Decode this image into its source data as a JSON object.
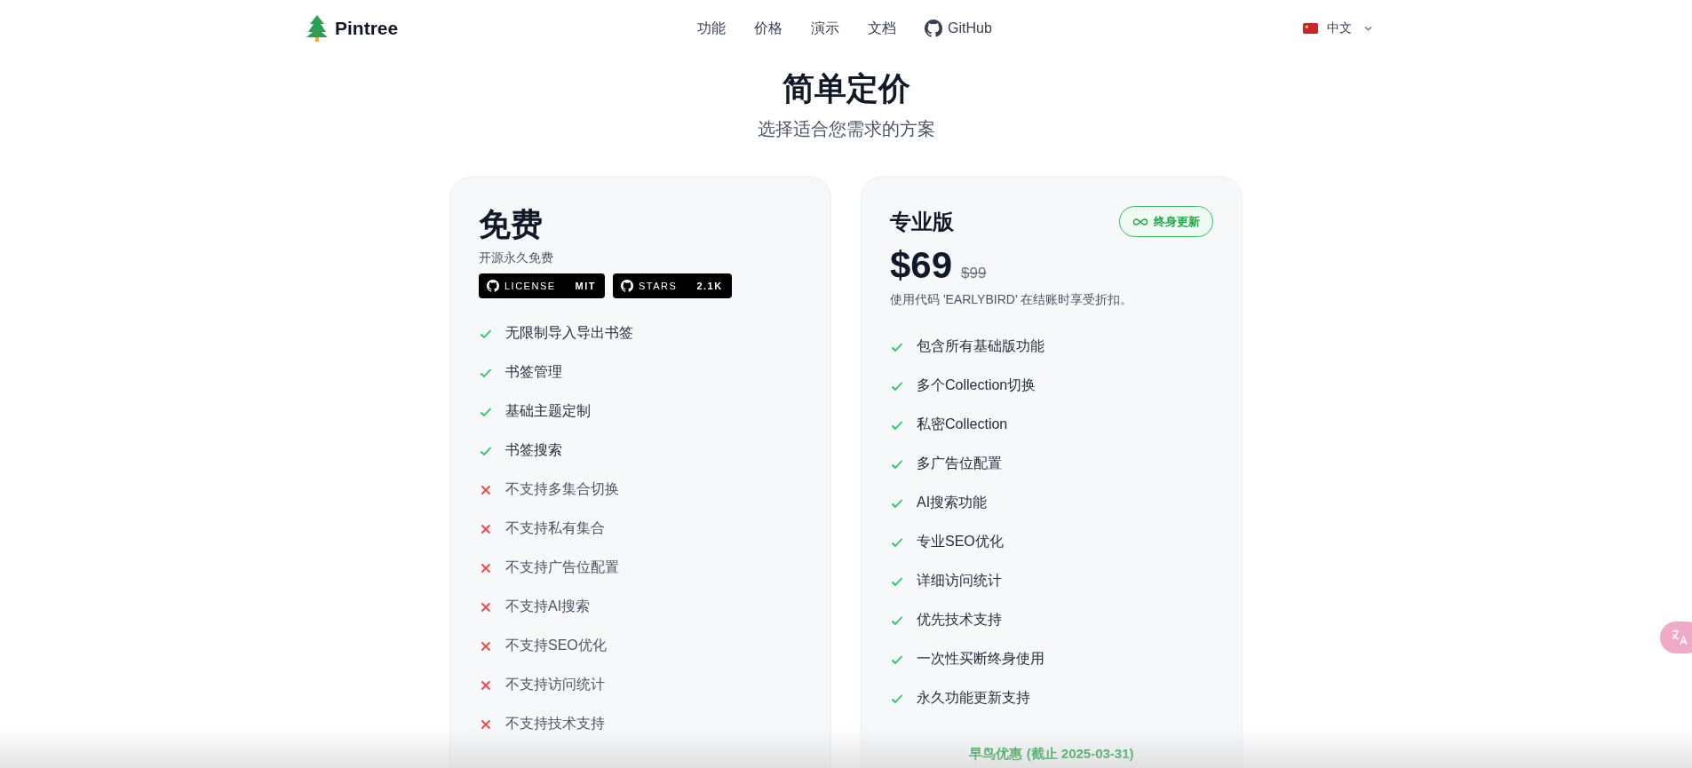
{
  "header": {
    "logo": "Pintree",
    "nav": [
      {
        "label": "功能",
        "kind": "text"
      },
      {
        "label": "价格",
        "kind": "text"
      },
      {
        "label": "演示",
        "kind": "text"
      },
      {
        "label": "文档",
        "kind": "text"
      },
      {
        "label": "GitHub",
        "kind": "github"
      }
    ],
    "language": "中文"
  },
  "hero": {
    "title": "简单定价",
    "subtitle": "选择适合您需求的方案"
  },
  "plans": [
    {
      "kind": "free",
      "name": "免费",
      "description": "开源永久免费",
      "shields": [
        {
          "label": "LICENSE",
          "value": "MIT"
        },
        {
          "label": "STARS",
          "value": "2.1K"
        }
      ],
      "features": [
        {
          "text": "无限制导入导出书签",
          "included": true
        },
        {
          "text": "书签管理",
          "included": true
        },
        {
          "text": "基础主题定制",
          "included": true
        },
        {
          "text": "书签搜索",
          "included": true
        },
        {
          "text": "不支持多集合切换",
          "included": false
        },
        {
          "text": "不支持私有集合",
          "included": false
        },
        {
          "text": "不支持广告位配置",
          "included": false
        },
        {
          "text": "不支持AI搜索",
          "included": false
        },
        {
          "text": "不支持SEO优化",
          "included": false
        },
        {
          "text": "不支持访问统计",
          "included": false
        },
        {
          "text": "不支持技术支持",
          "included": false
        }
      ]
    },
    {
      "kind": "pro",
      "name": "专业版",
      "badge": "终身更新",
      "price": "$69",
      "old_price": "$99",
      "note": "使用代码 'EARLYBIRD' 在结账时享受折扣。",
      "features": [
        {
          "text": "包含所有基础版功能",
          "included": true
        },
        {
          "text": "多个Collection切换",
          "included": true
        },
        {
          "text": "私密Collection",
          "included": true
        },
        {
          "text": "多广告位配置",
          "included": true
        },
        {
          "text": "AI搜索功能",
          "included": true
        },
        {
          "text": "专业SEO优化",
          "included": true
        },
        {
          "text": "详细访问统计",
          "included": true
        },
        {
          "text": "优先技术支持",
          "included": true
        },
        {
          "text": "一次性买断终身使用",
          "included": true
        },
        {
          "text": "永久功能更新支持",
          "included": true
        }
      ],
      "offer": "早鸟优惠 (截止 2025-03-31)"
    }
  ]
}
